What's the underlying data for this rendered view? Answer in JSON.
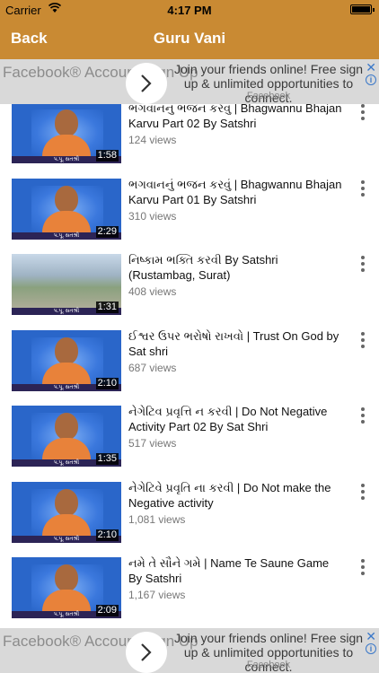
{
  "status_bar": {
    "carrier": "Carrier",
    "time": "4:17 PM",
    "battery_level": 1.0
  },
  "nav_bar": {
    "back_label": "Back",
    "title": "Guru Vani"
  },
  "ads": {
    "brand": "Facebook® Account Sign Up",
    "text": "Join your friends online! Free sign up & unlimited opportunities to connect.",
    "source": "Facebook",
    "close_symbol": "✕",
    "info_symbol": "i"
  },
  "thumb_caption": "પ.પૂ. સતશ્રી",
  "videos": [
    {
      "title": "ભગવાનનું ભજન કરવું | Bhagwannu Bhajan Karvu Part 02 By Satshri",
      "views": "124 views",
      "duration": "1:58",
      "thumb": "speaker"
    },
    {
      "title": "ભગવાનનું ભજન કરવું | Bhagwannu Bhajan Karvu Part 01 By Satshri",
      "views": "310 views",
      "duration": "2:29",
      "thumb": "speaker"
    },
    {
      "title": "નિષ્કામ ભક્તિ કરવી By Satshri (Rustambag, Surat)",
      "views": "408 views",
      "duration": "1:31",
      "thumb": "crowd"
    },
    {
      "title": "ઈશ્વર ઉપર ભરોષો રાખવો | Trust On God by Sat shri",
      "views": "687 views",
      "duration": "2:10",
      "thumb": "speaker"
    },
    {
      "title": "નેગેટિવ પ્રવૃત્તિ ન કરવી | Do Not Negative Activity Part 02 By Sat Shri",
      "views": "517 views",
      "duration": "1:35",
      "thumb": "speaker"
    },
    {
      "title": "નેગેટિવે પ્રવૃતિ ના કરવી | Do Not make the Negative activity",
      "views": "1,081 views",
      "duration": "2:10",
      "thumb": "speaker"
    },
    {
      "title": "નમે તે સૌને ગમે | Name Te Saune Game By Satshri",
      "views": "1,167 views",
      "duration": "2:09",
      "thumb": "speaker"
    }
  ]
}
